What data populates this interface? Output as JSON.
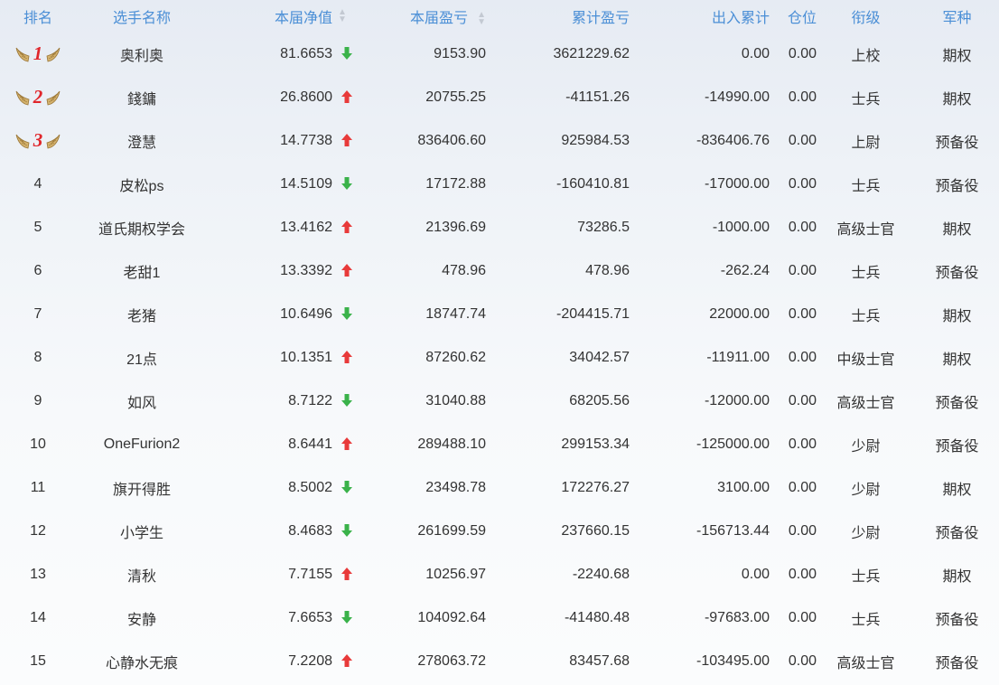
{
  "headers": {
    "rank": "排名",
    "name": "选手名称",
    "nav": "本届净值",
    "pnl": "本届盈亏",
    "cum": "累计盈亏",
    "io": "出入累计",
    "pos": "仓位",
    "military_rank": "衔级",
    "branch": "军种"
  },
  "colors": {
    "header_text": "#4b8fd6",
    "up": "#e83a3a",
    "down": "#3ab24a",
    "medal_number": "#e0262b",
    "medal_wing": "#c9a15a"
  },
  "rows": [
    {
      "rank": "1",
      "medal": true,
      "name": "奥利奥",
      "nav": "81.6653",
      "trend": "down",
      "pnl": "9153.90",
      "cum": "3621229.62",
      "io": "0.00",
      "pos": "0.00",
      "military_rank": "上校",
      "branch": "期权"
    },
    {
      "rank": "2",
      "medal": true,
      "name": "錢鏞",
      "nav": "26.8600",
      "trend": "up",
      "pnl": "20755.25",
      "cum": "-41151.26",
      "io": "-14990.00",
      "pos": "0.00",
      "military_rank": "士兵",
      "branch": "期权"
    },
    {
      "rank": "3",
      "medal": true,
      "name": "澄慧",
      "nav": "14.7738",
      "trend": "up",
      "pnl": "836406.60",
      "cum": "925984.53",
      "io": "-836406.76",
      "pos": "0.00",
      "military_rank": "上尉",
      "branch": "预备役"
    },
    {
      "rank": "4",
      "medal": false,
      "name": "皮松ps",
      "nav": "14.5109",
      "trend": "down",
      "pnl": "17172.88",
      "cum": "-160410.81",
      "io": "-17000.00",
      "pos": "0.00",
      "military_rank": "士兵",
      "branch": "预备役"
    },
    {
      "rank": "5",
      "medal": false,
      "name": "道氏期权学会",
      "nav": "13.4162",
      "trend": "up",
      "pnl": "21396.69",
      "cum": "73286.5",
      "io": "-1000.00",
      "pos": "0.00",
      "military_rank": "高级士官",
      "branch": "期权"
    },
    {
      "rank": "6",
      "medal": false,
      "name": "老甜1",
      "nav": "13.3392",
      "trend": "up",
      "pnl": "478.96",
      "cum": "478.96",
      "io": "-262.24",
      "pos": "0.00",
      "military_rank": "士兵",
      "branch": "预备役"
    },
    {
      "rank": "7",
      "medal": false,
      "name": "老猪",
      "nav": "10.6496",
      "trend": "down",
      "pnl": "18747.74",
      "cum": "-204415.71",
      "io": "22000.00",
      "pos": "0.00",
      "military_rank": "士兵",
      "branch": "期权"
    },
    {
      "rank": "8",
      "medal": false,
      "name": "21点",
      "nav": "10.1351",
      "trend": "up",
      "pnl": "87260.62",
      "cum": "34042.57",
      "io": "-11911.00",
      "pos": "0.00",
      "military_rank": "中级士官",
      "branch": "期权"
    },
    {
      "rank": "9",
      "medal": false,
      "name": "如风",
      "nav": "8.7122",
      "trend": "down",
      "pnl": "31040.88",
      "cum": "68205.56",
      "io": "-12000.00",
      "pos": "0.00",
      "military_rank": "高级士官",
      "branch": "预备役"
    },
    {
      "rank": "10",
      "medal": false,
      "name": "OneFurion2",
      "nav": "8.6441",
      "trend": "up",
      "pnl": "289488.10",
      "cum": "299153.34",
      "io": "-125000.00",
      "pos": "0.00",
      "military_rank": "少尉",
      "branch": "预备役"
    },
    {
      "rank": "11",
      "medal": false,
      "name": "旗开得胜",
      "nav": "8.5002",
      "trend": "down",
      "pnl": "23498.78",
      "cum": "172276.27",
      "io": "3100.00",
      "pos": "0.00",
      "military_rank": "少尉",
      "branch": "期权"
    },
    {
      "rank": "12",
      "medal": false,
      "name": "小学生",
      "nav": "8.4683",
      "trend": "down",
      "pnl": "261699.59",
      "cum": "237660.15",
      "io": "-156713.44",
      "pos": "0.00",
      "military_rank": "少尉",
      "branch": "预备役"
    },
    {
      "rank": "13",
      "medal": false,
      "name": "清秋",
      "nav": "7.7155",
      "trend": "up",
      "pnl": "10256.97",
      "cum": "-2240.68",
      "io": "0.00",
      "pos": "0.00",
      "military_rank": "士兵",
      "branch": "期权"
    },
    {
      "rank": "14",
      "medal": false,
      "name": "安静",
      "nav": "7.6653",
      "trend": "down",
      "pnl": "104092.64",
      "cum": "-41480.48",
      "io": "-97683.00",
      "pos": "0.00",
      "military_rank": "士兵",
      "branch": "预备役"
    },
    {
      "rank": "15",
      "medal": false,
      "name": "心静水无痕",
      "nav": "7.2208",
      "trend": "up",
      "pnl": "278063.72",
      "cum": "83457.68",
      "io": "-103495.00",
      "pos": "0.00",
      "military_rank": "高级士官",
      "branch": "预备役"
    }
  ]
}
